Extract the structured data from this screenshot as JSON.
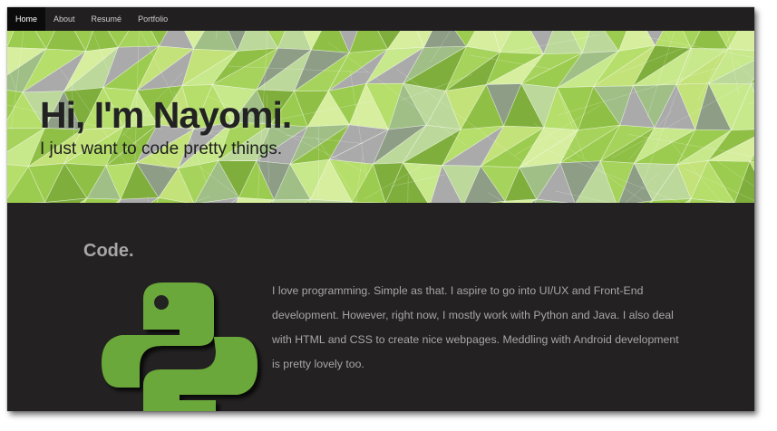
{
  "nav": {
    "items": [
      {
        "label": "Home",
        "active": true
      },
      {
        "label": "About",
        "active": false
      },
      {
        "label": "Resumé",
        "active": false
      },
      {
        "label": "Portfolio",
        "active": false
      }
    ]
  },
  "hero": {
    "title": "Hi, I'm Nayomi.",
    "subtitle": "I just want to code pretty things."
  },
  "section": {
    "title": "Code.",
    "body": "I love programming. Simple as that. I aspire to go into UI/UX and Front-End development. However, right now, I mostly work with Python and Java. I also deal with HTML and CSS to create nice webpages. Meddling with Android development is pretty lovely too.",
    "icon": "python-logo-icon"
  },
  "colors": {
    "accent": "#6aa83a",
    "background": "#232122",
    "nav_background": "#211f20",
    "text": "#a7a7a7"
  }
}
